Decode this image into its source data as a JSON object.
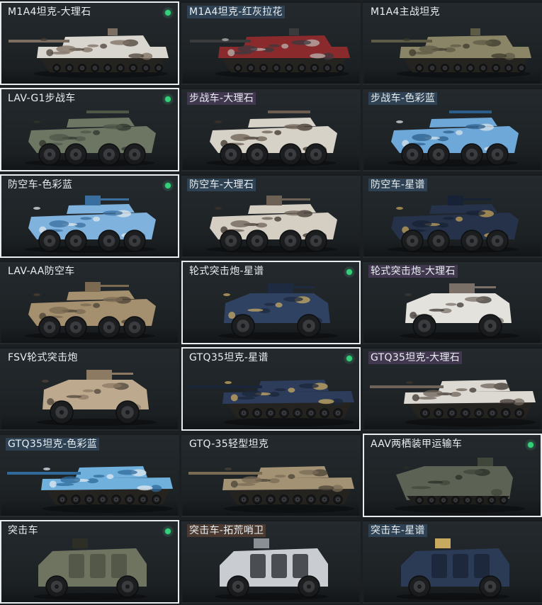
{
  "vehicles": [
    {
      "name": "M1A4坦克-大理石",
      "tag": "none",
      "selected": true,
      "equipped": true,
      "kind": "tank",
      "colors": [
        "#d9d6cf",
        "#7c6e60",
        "#4a3f36"
      ]
    },
    {
      "name": "M1A4坦克-红灰拉花",
      "tag": "blue",
      "selected": false,
      "equipped": false,
      "kind": "tank",
      "colors": [
        "#8b2a2c",
        "#3b3a3d",
        "#b9b4b0"
      ]
    },
    {
      "name": "M1A4主战坦克",
      "tag": "none",
      "selected": false,
      "equipped": false,
      "kind": "tank",
      "colors": [
        "#8a8566",
        "#5d5a45",
        "#3b3a2d"
      ]
    },
    {
      "name": "LAV-G1步战车",
      "tag": "none",
      "selected": true,
      "equipped": true,
      "kind": "ifv",
      "colors": [
        "#6c7663",
        "#4d5647",
        "#2f342c"
      ]
    },
    {
      "name": "步战车-大理石",
      "tag": "purple",
      "selected": false,
      "equipped": false,
      "kind": "ifv",
      "colors": [
        "#d7d2c8",
        "#6b5e51",
        "#3e342c"
      ]
    },
    {
      "name": "步战车-色彩蓝",
      "tag": "blue",
      "selected": false,
      "equipped": false,
      "kind": "ifv",
      "colors": [
        "#6ea8d8",
        "#2e5f8c",
        "#d8e3ea"
      ]
    },
    {
      "name": "防空车-色彩蓝",
      "tag": "none",
      "selected": true,
      "equipped": true,
      "kind": "aa",
      "colors": [
        "#7fb2dc",
        "#3a6e9e",
        "#dfe8ee"
      ]
    },
    {
      "name": "防空车-大理石",
      "tag": "blue",
      "selected": false,
      "equipped": false,
      "kind": "aa",
      "colors": [
        "#d4cec3",
        "#6d6055",
        "#3d342d"
      ]
    },
    {
      "name": "防空车-星谱",
      "tag": "blue",
      "selected": false,
      "equipped": false,
      "kind": "aa",
      "colors": [
        "#25324a",
        "#182236",
        "#c2a35a"
      ]
    },
    {
      "name": "LAV-AA防空车",
      "tag": "none",
      "selected": false,
      "equipped": false,
      "kind": "aa",
      "colors": [
        "#a48f6f",
        "#7b6a51",
        "#4b4033"
      ]
    },
    {
      "name": "轮式突击炮-星谱",
      "tag": "none",
      "selected": true,
      "equipped": true,
      "kind": "assault",
      "colors": [
        "#2f4262",
        "#1d2a40",
        "#c8aa63"
      ]
    },
    {
      "name": "轮式突击炮-大理石",
      "tag": "purple",
      "selected": false,
      "equipped": false,
      "kind": "assault",
      "colors": [
        "#e4e2dd",
        "#7a7068",
        "#3e3732"
      ]
    },
    {
      "name": "FSV轮式突击炮",
      "tag": "none",
      "selected": false,
      "equipped": false,
      "kind": "assault",
      "colors": [
        "#bda98e",
        "#8c7a63",
        "#4f4539"
      ]
    },
    {
      "name": "GTQ35坦克-星谱",
      "tag": "none",
      "selected": true,
      "equipped": true,
      "kind": "light",
      "colors": [
        "#2c3c5a",
        "#1b2539",
        "#c8aa63"
      ]
    },
    {
      "name": "GTQ35坦克-大理石",
      "tag": "purple",
      "selected": false,
      "equipped": false,
      "kind": "light",
      "colors": [
        "#dcd8d2",
        "#6e645a",
        "#3c342e"
      ]
    },
    {
      "name": "GTQ35坦克-色彩蓝",
      "tag": "blue",
      "selected": false,
      "equipped": false,
      "kind": "light",
      "colors": [
        "#6fb0dc",
        "#2f6a9b",
        "#e0eaf1"
      ]
    },
    {
      "name": "GTQ-35轻型坦克",
      "tag": "none",
      "selected": false,
      "equipped": false,
      "kind": "light",
      "colors": [
        "#a49275",
        "#7a6b55",
        "#4a4135"
      ]
    },
    {
      "name": "AAV两栖装甲运输车",
      "tag": "none",
      "selected": true,
      "equipped": true,
      "kind": "aav",
      "colors": [
        "#5d6354",
        "#41463b",
        "#2a2d26"
      ]
    },
    {
      "name": "突击车",
      "tag": "none",
      "selected": true,
      "equipped": true,
      "kind": "mrap",
      "colors": [
        "#6f7460",
        "#4d5142",
        "#2d2f27"
      ]
    },
    {
      "name": "突击车-拓荒哨卫",
      "tag": "brown",
      "selected": false,
      "equipped": false,
      "kind": "mrap",
      "colors": [
        "#c9ccd0",
        "#2a2d31",
        "#8a8f95"
      ]
    },
    {
      "name": "突击车-星谱",
      "tag": "blue",
      "selected": false,
      "equipped": false,
      "kind": "mrap",
      "colors": [
        "#2b3a55",
        "#1a2436",
        "#c7a960"
      ]
    }
  ]
}
